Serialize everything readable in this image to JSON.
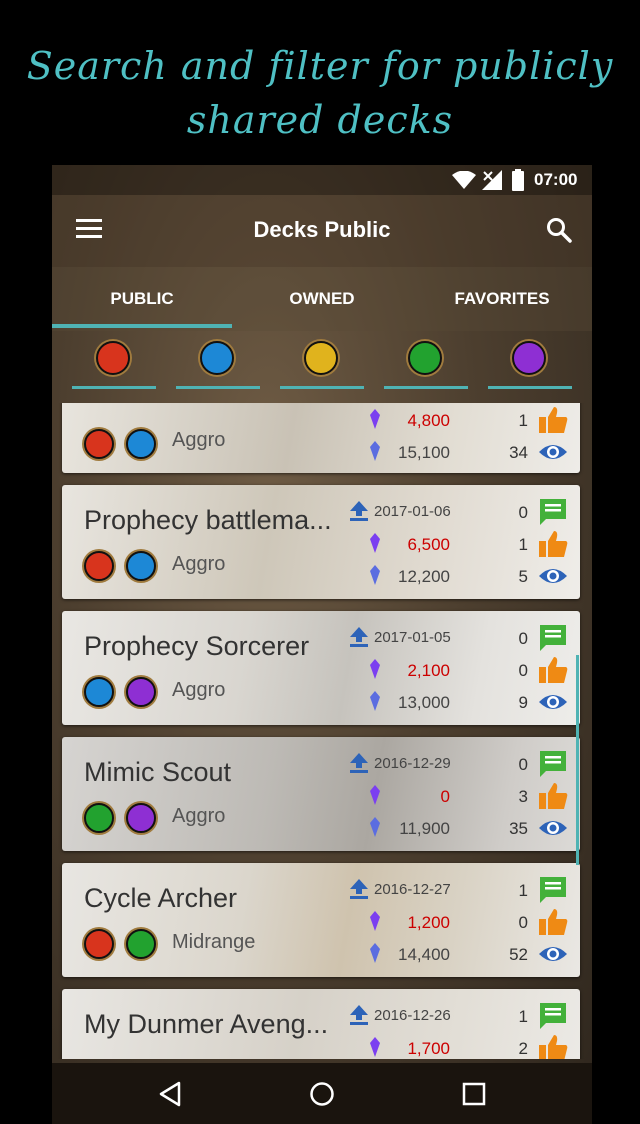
{
  "promo": {
    "line1": "Search and filter for publicly",
    "line2": "shared decks"
  },
  "status": {
    "time": "07:00"
  },
  "appbar": {
    "title": "Decks Public"
  },
  "tabs": [
    {
      "label": "PUBLIC"
    },
    {
      "label": "OWNED"
    },
    {
      "label": "FAVORITES"
    }
  ],
  "filters": [
    {
      "name": "strength",
      "color": "#d8341d"
    },
    {
      "name": "intelligence",
      "color": "#1d88d6"
    },
    {
      "name": "willpower",
      "color": "#e0b31d"
    },
    {
      "name": "agility",
      "color": "#22a22f"
    },
    {
      "name": "endurance",
      "color": "#8e2fd3"
    }
  ],
  "decks": [
    {
      "name": "",
      "date": "",
      "archetype": "Aggro",
      "cost_red": "4,800",
      "cost_blue": "15,100",
      "comments": "",
      "likes": "1",
      "views": "34",
      "attrs": [
        "#d8341d",
        "#1d88d6"
      ]
    },
    {
      "name": "Prophecy battlema...",
      "date": "2017-01-06",
      "archetype": "Aggro",
      "cost_red": "6,500",
      "cost_blue": "12,200",
      "comments": "0",
      "likes": "1",
      "views": "5",
      "attrs": [
        "#d8341d",
        "#1d88d6"
      ]
    },
    {
      "name": "Prophecy Sorcerer",
      "date": "2017-01-05",
      "archetype": "Aggro",
      "cost_red": "2,100",
      "cost_blue": "13,000",
      "comments": "0",
      "likes": "0",
      "views": "9",
      "attrs": [
        "#1d88d6",
        "#8e2fd3"
      ]
    },
    {
      "name": "Mimic Scout",
      "date": "2016-12-29",
      "archetype": "Aggro",
      "cost_red": "0",
      "cost_blue": "11,900",
      "comments": "0",
      "likes": "3",
      "views": "35",
      "attrs": [
        "#22a22f",
        "#8e2fd3"
      ]
    },
    {
      "name": "Cycle Archer",
      "date": "2016-12-27",
      "archetype": "Midrange",
      "cost_red": "1,200",
      "cost_blue": "14,400",
      "comments": "1",
      "likes": "0",
      "views": "52",
      "attrs": [
        "#d8341d",
        "#22a22f"
      ]
    },
    {
      "name": "My Dunmer Aveng...",
      "date": "2016-12-26",
      "archetype": "",
      "cost_red": "1,700",
      "cost_blue": "",
      "comments": "1",
      "likes": "2",
      "views": "",
      "attrs": []
    }
  ],
  "colors": {
    "accent": "#4fb3b4",
    "comment": "#43b13a",
    "like": "#ef8a14",
    "view": "#2d63b8",
    "crystal": "#7b3ff0"
  }
}
